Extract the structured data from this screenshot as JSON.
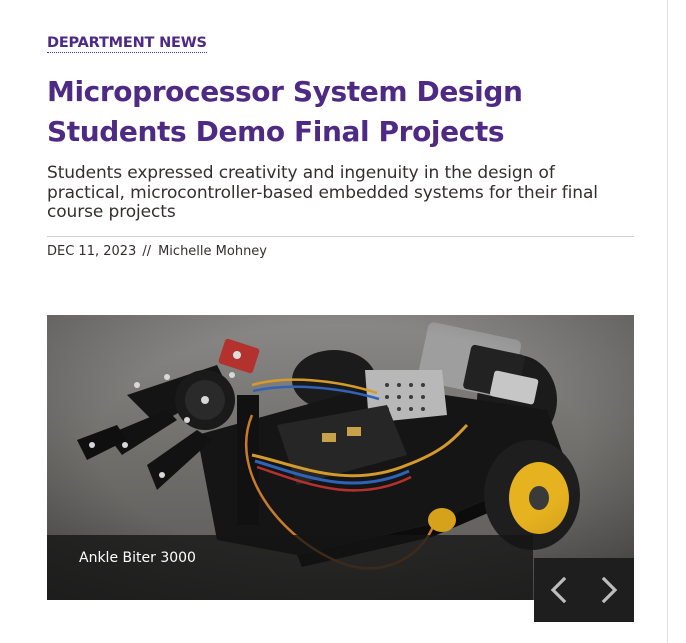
{
  "article": {
    "category": "DEPARTMENT NEWS",
    "headline": "Microprocessor System Design Students Demo Final Projects",
    "dek": "Students expressed creativity and ingenuity in the design of practical, microcontroller-based embedded systems for their final course projects",
    "date": "DEC 11, 2023",
    "separator": "//",
    "author": "Michelle Mohney"
  },
  "slideshow": {
    "caption": "Ankle Biter 3000",
    "prev_icon": "chevron-left-icon",
    "next_icon": "chevron-right-icon"
  },
  "colors": {
    "brand_purple": "#4e2a84",
    "body_text": "#342f2e",
    "control_bg": "#1e1e1e"
  }
}
